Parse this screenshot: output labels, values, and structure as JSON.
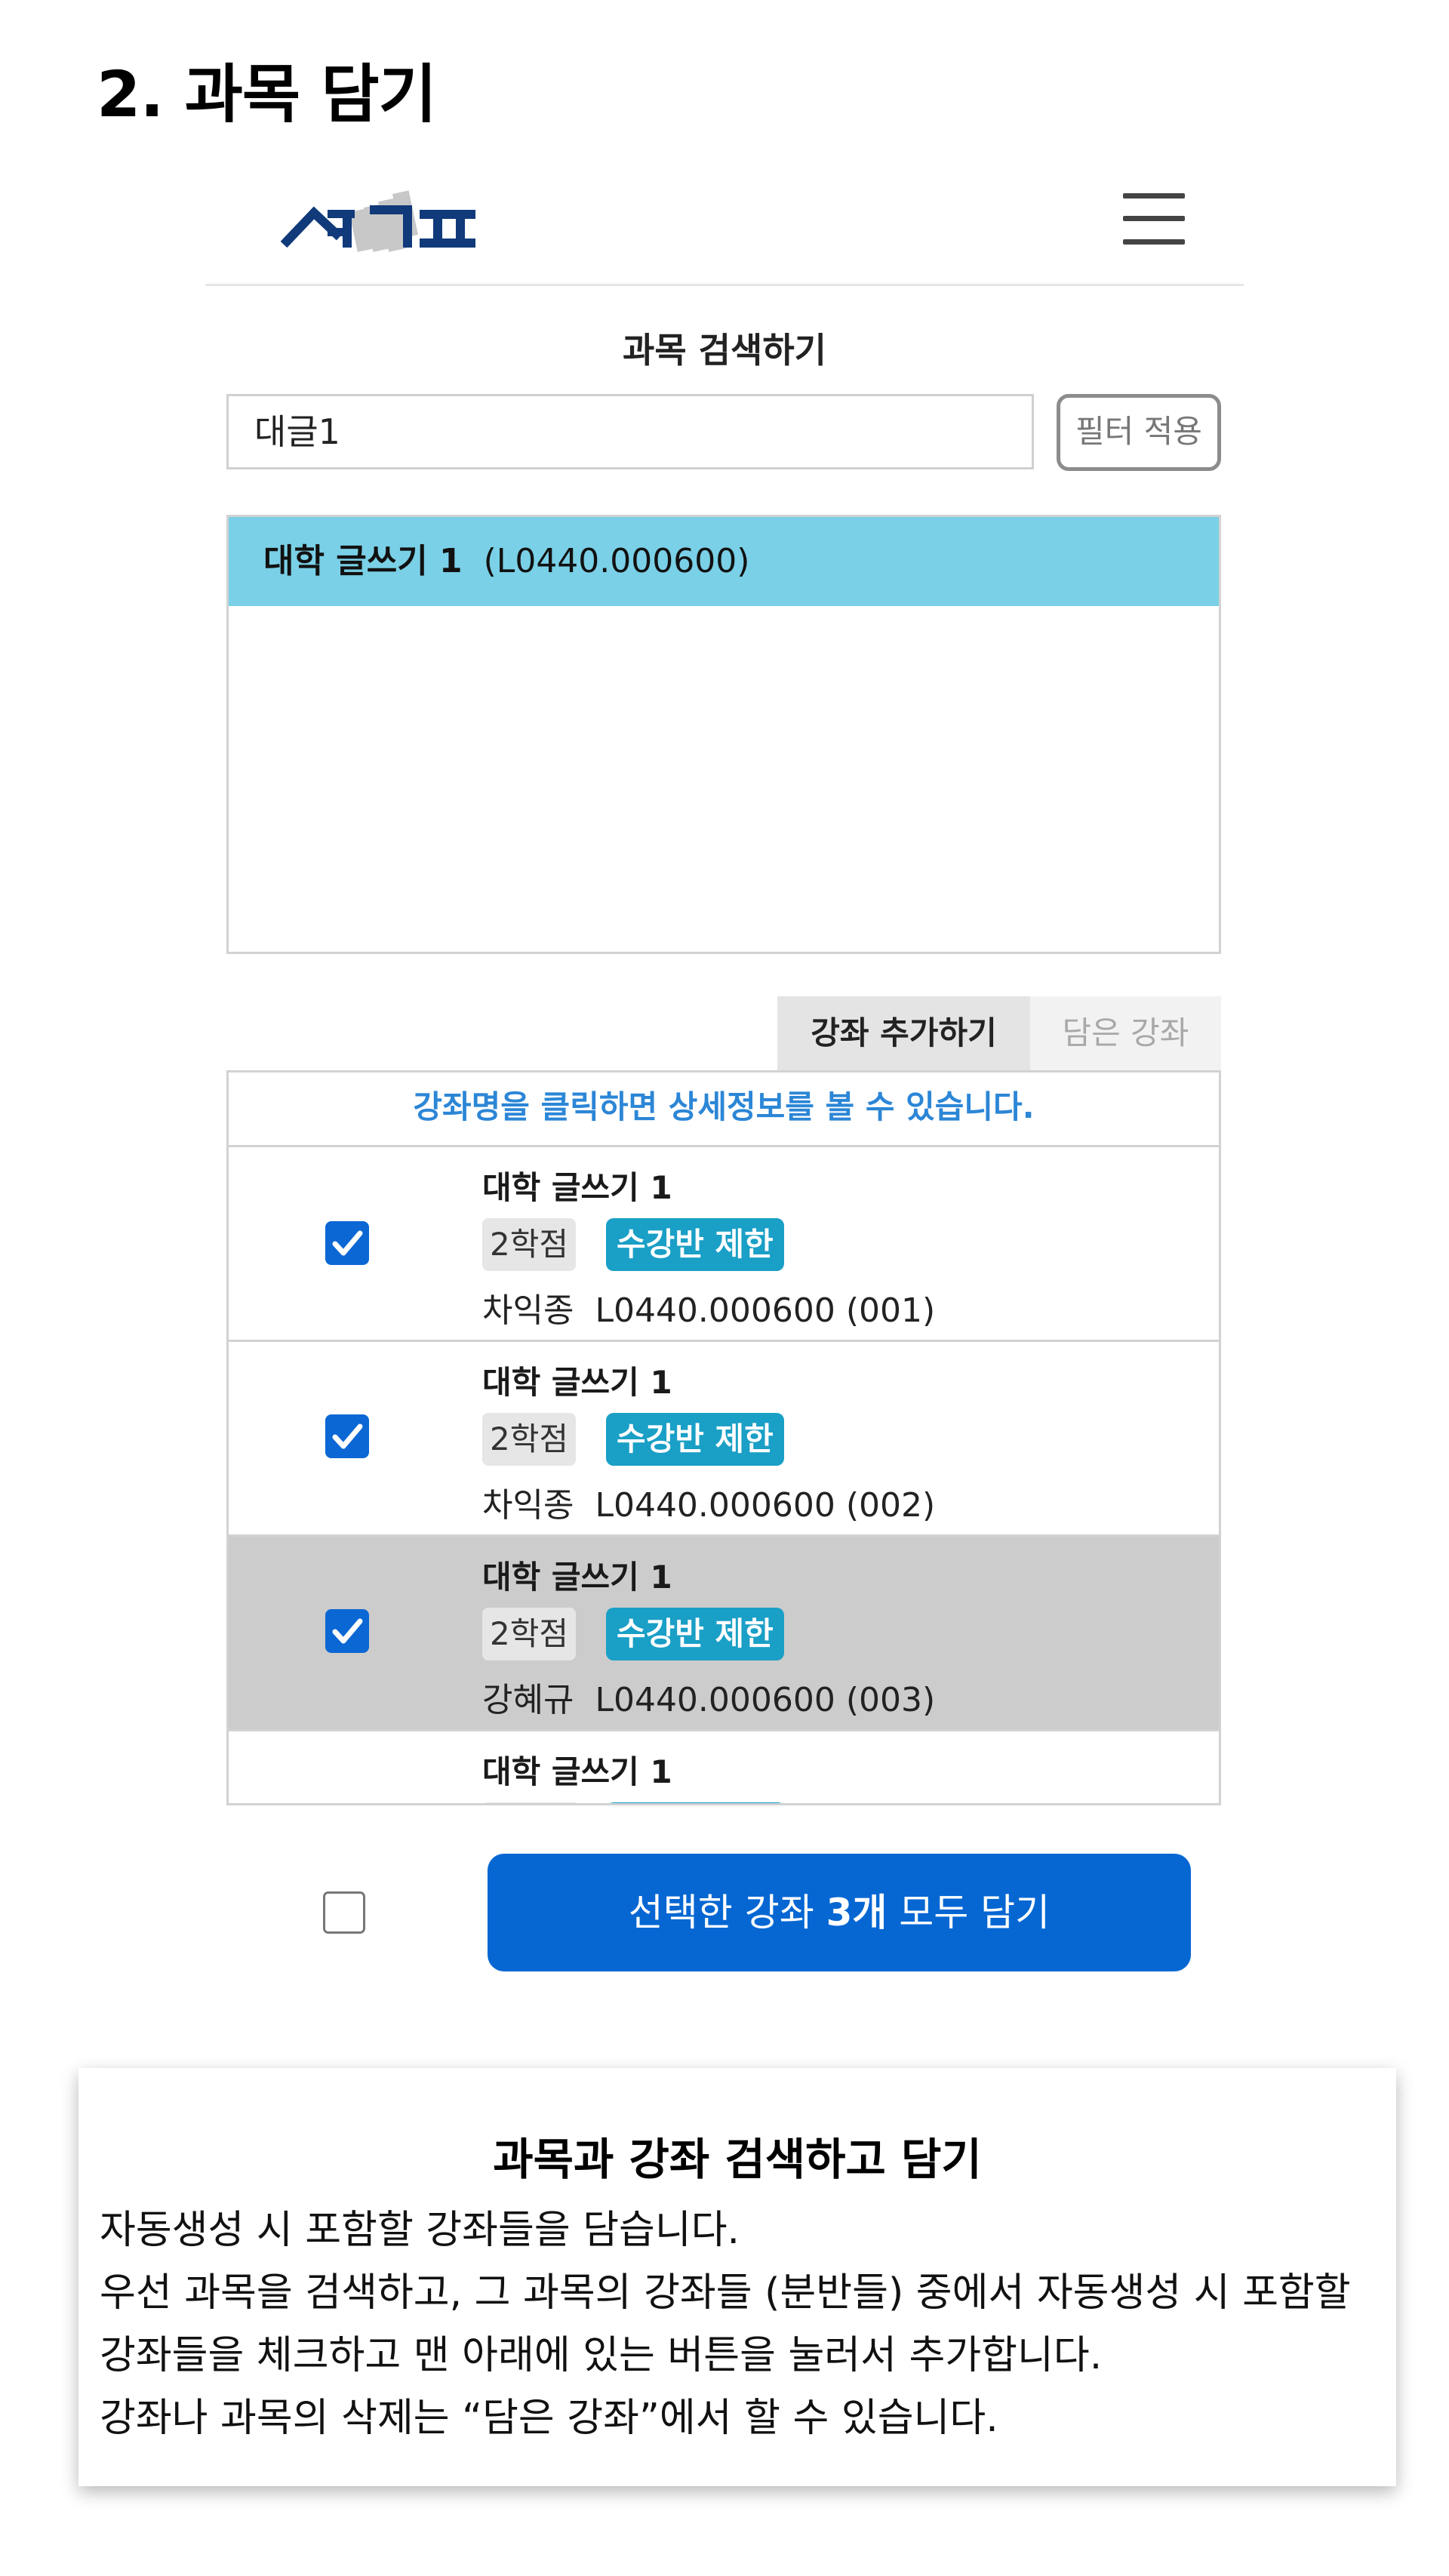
{
  "page": {
    "heading": "2. 과목 담기"
  },
  "app": {
    "logo_text": "사계고",
    "brand_color": "#103a7a"
  },
  "search": {
    "title": "과목 검색하기",
    "input_value": "대글1",
    "filter_button": "필터 적용"
  },
  "results": [
    {
      "name": "대학 글쓰기 1",
      "code": "(L0440.000600)"
    }
  ],
  "tabs": {
    "add": "강좌 추가하기",
    "saved": "담은 강좌"
  },
  "sections": {
    "hint": "강좌명을 클릭하면 상세정보를 볼 수 있습니다.",
    "items": [
      {
        "title": "대학 글쓰기 1",
        "credit": "2학점",
        "restriction": "수강반 제한",
        "professor": "차익종",
        "code": "L0440.000600 (001)",
        "checked": true,
        "selected": false
      },
      {
        "title": "대학 글쓰기 1",
        "credit": "2학점",
        "restriction": "수강반 제한",
        "professor": "차익종",
        "code": "L0440.000600 (002)",
        "checked": true,
        "selected": false
      },
      {
        "title": "대학 글쓰기 1",
        "credit": "2학점",
        "restriction": "수강반 제한",
        "professor": "강혜규",
        "code": "L0440.000600 (003)",
        "checked": true,
        "selected": true
      },
      {
        "title": "대학 글쓰기 1",
        "credit": "",
        "restriction": "",
        "professor": "",
        "code": "",
        "checked": false,
        "selected": false
      }
    ]
  },
  "bottom": {
    "button_prefix": "선택한 강좌 ",
    "button_count": "3개",
    "button_suffix": " 모두 담기",
    "select_all_checked": false
  },
  "card": {
    "title": "과목과 강좌 검색하고 담기",
    "lines": [
      "자동생성 시 포함할 강좌들을 담습니다.",
      "우선 과목을 검색하고, 그 과목의 강좌들 (분반들) 중에서 자동생성 시 포함할",
      "강좌들을 체크하고 맨 아래에 있는 버튼을 눌러서 추가합니다.",
      "강좌나 과목의 삭제는 “담은 강좌”에서 할 수 있습니다."
    ]
  },
  "colors": {
    "accent": "#0667d3",
    "result_highlight": "#7ad0e6",
    "badge_restriction": "#1a9fc6",
    "hint_text": "#2c86d6",
    "selected_row": "#cccccc"
  }
}
